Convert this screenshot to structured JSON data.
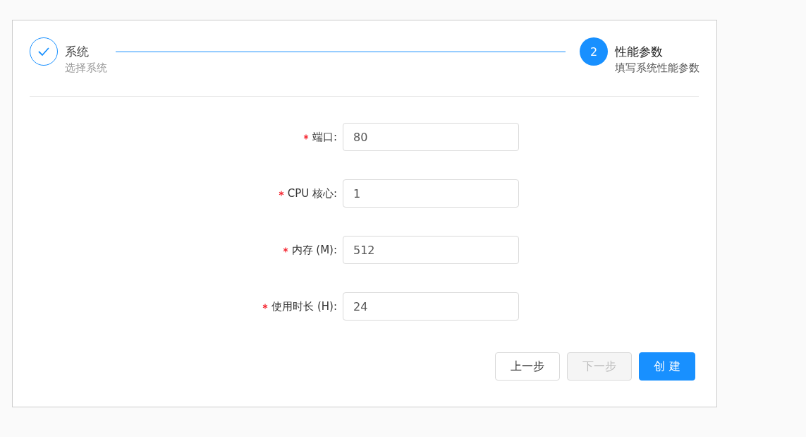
{
  "steps": [
    {
      "completed": true,
      "title": "系统",
      "description": "选择系统"
    },
    {
      "completed": false,
      "index": "2",
      "title": "性能参数",
      "description": "填写系统性能参数"
    }
  ],
  "form": {
    "fields": [
      {
        "label": "端口:",
        "required": true,
        "value": "80"
      },
      {
        "label": "CPU 核心:",
        "required": true,
        "value": "1"
      },
      {
        "label": "内存 (M):",
        "required": true,
        "value": "512"
      },
      {
        "label": "使用时长 (H):",
        "required": true,
        "value": "24"
      }
    ]
  },
  "buttons": [
    {
      "label": "上一步",
      "kind": "default",
      "disabled": false
    },
    {
      "label": "下一步",
      "kind": "default",
      "disabled": true
    },
    {
      "label": "创 建",
      "kind": "primary",
      "disabled": false
    }
  ]
}
